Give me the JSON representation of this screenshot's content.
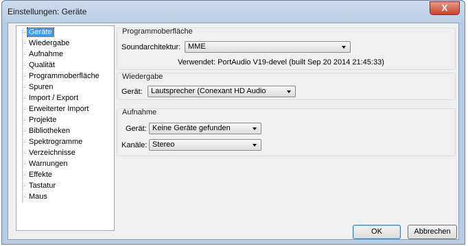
{
  "window": {
    "title": "Einstellungen: Geräte",
    "close_label": "X"
  },
  "tree": {
    "items": [
      {
        "label": "Geräte",
        "selected": true
      },
      {
        "label": "Wiedergabe"
      },
      {
        "label": "Aufnahme"
      },
      {
        "label": "Qualität"
      },
      {
        "label": "Programmoberfläche"
      },
      {
        "label": "Spuren"
      },
      {
        "label": "Import / Export"
      },
      {
        "label": "Erweiterter Import"
      },
      {
        "label": "Projekte"
      },
      {
        "label": "Bibliotheken"
      },
      {
        "label": "Spektrogramme"
      },
      {
        "label": "Verzeichnisse"
      },
      {
        "label": "Warnungen"
      },
      {
        "label": "Effekte"
      },
      {
        "label": "Tastatur"
      },
      {
        "label": "Maus"
      }
    ]
  },
  "interface": {
    "title": "Programmoberfläche",
    "host_label": "Soundarchitektur:",
    "host_value": "MME",
    "using_text": "Verwendet: PortAudio V19-devel (built Sep 20 2014 21:45:33)"
  },
  "playback": {
    "title": "Wiedergabe",
    "device_label": "Gerät:",
    "device_value": "Lautsprecher (Conexant HD Audio"
  },
  "recording": {
    "title": "Aufnahme",
    "device_label": "Gerät:",
    "device_value": "Keine Geräte gefunden",
    "channels_label": "Kanäle:",
    "channels_value": "Stereo"
  },
  "buttons": {
    "ok": "OK",
    "cancel": "Abbrechen"
  }
}
